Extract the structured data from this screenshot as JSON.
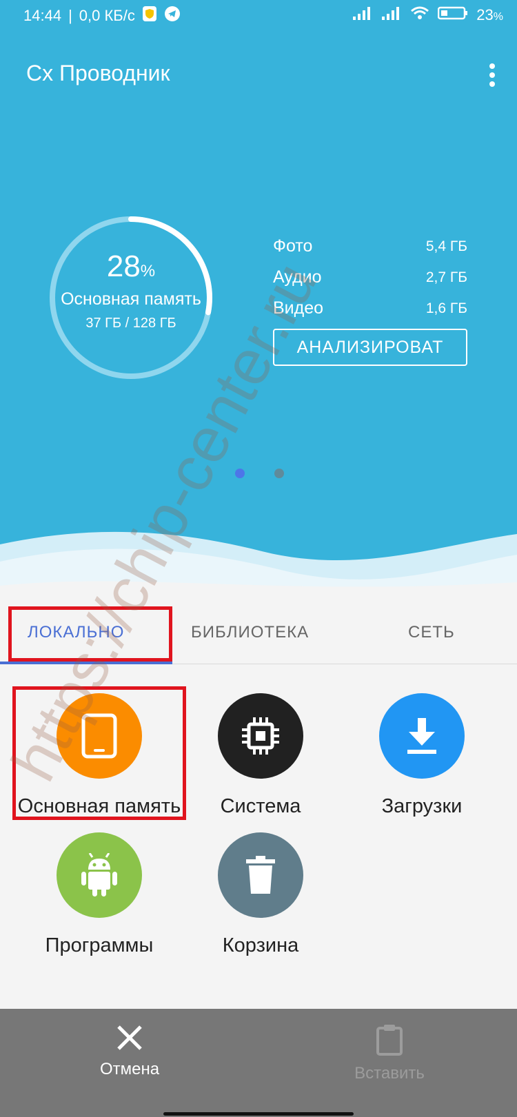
{
  "status_bar": {
    "time": "14:44",
    "separator": "|",
    "network_speed": "0,0 КБ/с",
    "battery_percent": "23",
    "battery_suffix": "%"
  },
  "app": {
    "title": "Cx Проводник"
  },
  "storage": {
    "percent": "28",
    "percent_suffix": "%",
    "used_fraction": 0.28,
    "label": "Основная память",
    "size": "37 ГБ / 128 ГБ",
    "categories": [
      {
        "name": "Фото",
        "size": "5,4 ГБ"
      },
      {
        "name": "Аудио",
        "size": "2,7 ГБ"
      },
      {
        "name": "Видео",
        "size": "1,6 ГБ"
      }
    ],
    "analyze_button": "АНАЛИЗИРОВАТ"
  },
  "pager": {
    "count": 2,
    "active": 0
  },
  "tabs": [
    {
      "label": "ЛОКАЛЬНО",
      "active": true
    },
    {
      "label": "БИБЛИОТЕКА",
      "active": false
    },
    {
      "label": "СЕТЬ",
      "active": false
    }
  ],
  "grid": [
    {
      "label": "Основная память",
      "icon": "phone-icon",
      "color": "#fb8c00"
    },
    {
      "label": "Система",
      "icon": "chip-icon",
      "color": "#212121"
    },
    {
      "label": "Загрузки",
      "icon": "download-icon",
      "color": "#2196f3"
    },
    {
      "label": "Программы",
      "icon": "android-icon",
      "color": "#8bc34a"
    },
    {
      "label": "Корзина",
      "icon": "trash-icon",
      "color": "#607d8b"
    }
  ],
  "bottom_bar": {
    "cancel_label": "Отмена",
    "paste_label": "Вставить"
  },
  "watermark": "https://chip-center.ru",
  "colors": {
    "header_bg": "#37b3db",
    "accent": "#4a6fd4",
    "highlight": "#e0141e",
    "bottom_bar": "#777777"
  }
}
